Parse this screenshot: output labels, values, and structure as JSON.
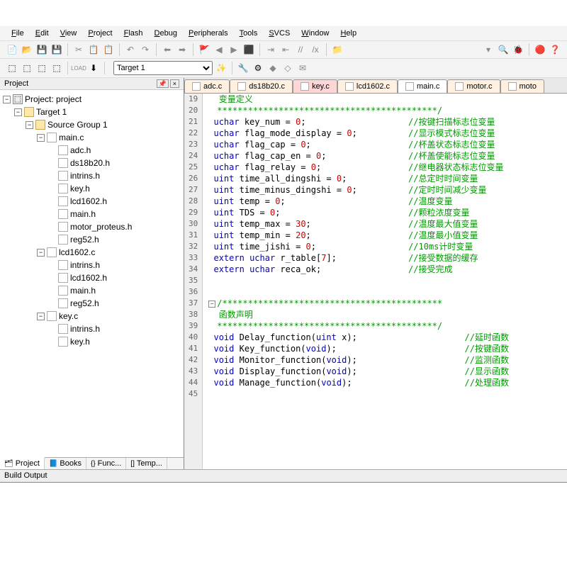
{
  "menu": [
    "File",
    "Edit",
    "View",
    "Project",
    "Flash",
    "Debug",
    "Peripherals",
    "Tools",
    "SVCS",
    "Window",
    "Help"
  ],
  "target_select": "Target 1",
  "project_panel": {
    "title": "Project",
    "root": "Project: project",
    "target": "Target 1",
    "group": "Source Group 1",
    "files": [
      {
        "name": "main.c",
        "children": [
          "adc.h",
          "ds18b20.h",
          "intrins.h",
          "key.h",
          "lcd1602.h",
          "main.h",
          "motor_proteus.h",
          "reg52.h"
        ]
      },
      {
        "name": "lcd1602.c",
        "children": [
          "intrins.h",
          "lcd1602.h",
          "main.h",
          "reg52.h"
        ]
      },
      {
        "name": "key.c",
        "children": [
          "intrins.h",
          "key.h"
        ]
      }
    ],
    "bottom_tabs": [
      "Project",
      "Books",
      "Func...",
      "Temp..."
    ]
  },
  "file_tabs": [
    {
      "label": "adc.c",
      "cls": ""
    },
    {
      "label": "ds18b20.c",
      "cls": ""
    },
    {
      "label": "key.c",
      "cls": "red"
    },
    {
      "label": "lcd1602.c",
      "cls": ""
    },
    {
      "label": "main.c",
      "cls": "active"
    },
    {
      "label": "motor.c",
      "cls": ""
    },
    {
      "label": "moto",
      "cls": ""
    }
  ],
  "code_start": 19,
  "code_lines": [
    {
      "t": " 变量定义",
      "c": "cmt"
    },
    {
      "t": "*******************************************/",
      "c": "cmt",
      "fold": "close"
    },
    {
      "t": "uchar key_num = 0;",
      "cmt": "//按键扫描标志位变量"
    },
    {
      "t": "uchar flag_mode_display = 0;",
      "cmt": "//显示模式标志位变量"
    },
    {
      "t": "uchar flag_cap = 0;",
      "cmt": "//杯盖状态标志位变量"
    },
    {
      "t": "uchar flag_cap_en = 0;",
      "cmt": "//杯盖使能标志位变量"
    },
    {
      "t": "uchar flag_relay = 0;",
      "cmt": "//继电器状态标志位变量"
    },
    {
      "t": "uint time_all_dingshi = 0;",
      "cmt": "//总定时时间变量"
    },
    {
      "t": "uint time_minus_dingshi = 0;",
      "cmt": "//定时时间减少变量"
    },
    {
      "t": "uint temp = 0;",
      "cmt": "//温度变量"
    },
    {
      "t": "uint TDS = 0;",
      "cmt": "//颗粒浓度变量"
    },
    {
      "t": "uint temp_max = 30;",
      "cmt": "//温度最大值变量"
    },
    {
      "t": "uint temp_min = 20;",
      "cmt": "//温度最小值变量"
    },
    {
      "t": "uint time_jishi = 0;",
      "cmt": "//10ms计时变量"
    },
    {
      "t": "extern uchar r_table[7];",
      "cmt": "//接受数据的缓存"
    },
    {
      "t": "extern uchar reca_ok;",
      "cmt": "//接受完成"
    },
    {
      "t": "",
      "c": ""
    },
    {
      "t": "",
      "c": ""
    },
    {
      "t": "/*******************************************",
      "c": "cmt",
      "fold": "open"
    },
    {
      "t": " 函数声明",
      "c": "cmt"
    },
    {
      "t": "*******************************************/",
      "c": "cmt",
      "fold": "close"
    },
    {
      "t": "void Delay_function(uint x);",
      "cmt": "//延时函数",
      "col2": 49
    },
    {
      "t": "void Key_function(void);",
      "cmt": "//按键函数",
      "col2": 49
    },
    {
      "t": "void Monitor_function(void);",
      "cmt": "//监测函数",
      "col2": 49
    },
    {
      "t": "void Display_function(void);",
      "cmt": "//显示函数",
      "col2": 49
    },
    {
      "t": "void Manage_function(void);",
      "cmt": "//处理函数",
      "col2": 49
    },
    {
      "t": "",
      "c": ""
    }
  ],
  "build_output_title": "Build Output"
}
